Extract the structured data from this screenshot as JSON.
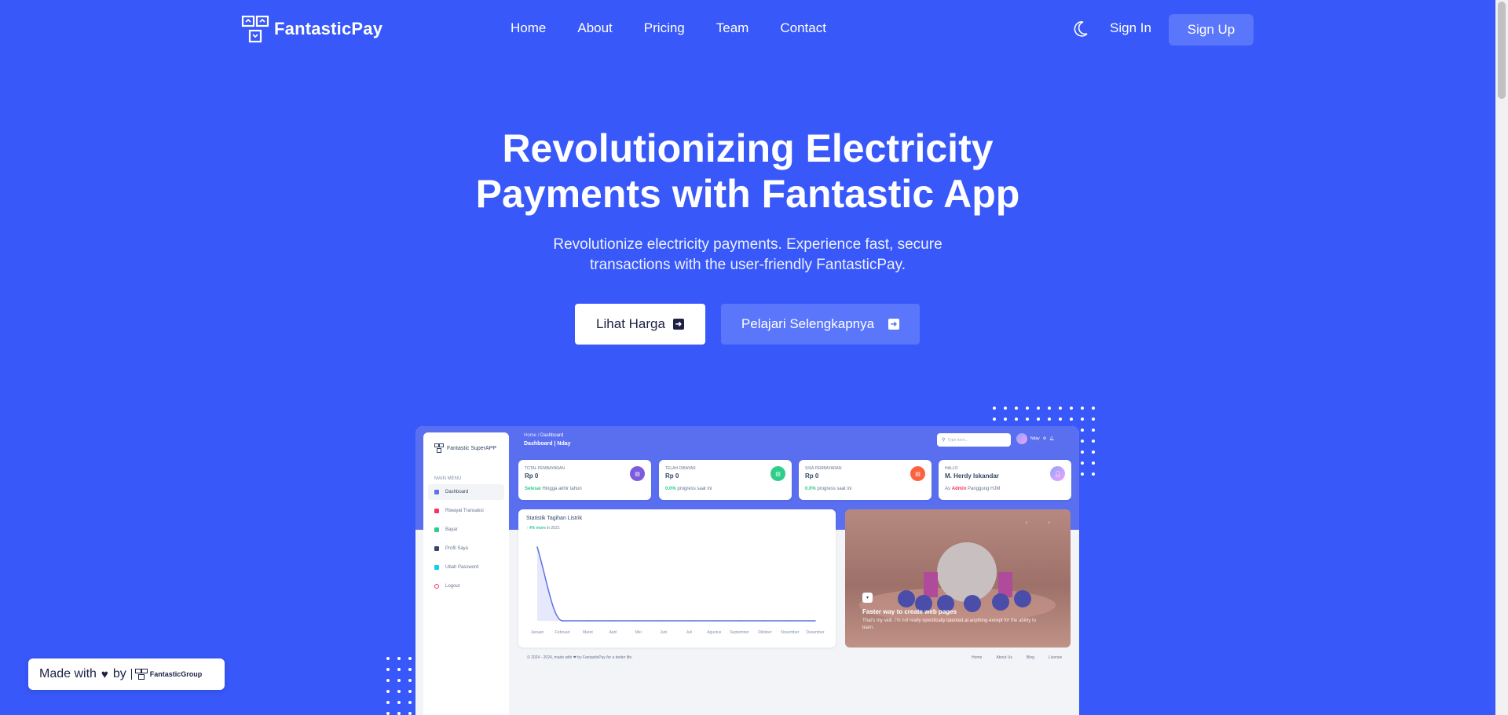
{
  "brand": {
    "name": "FantasticPay"
  },
  "nav": {
    "links": [
      "Home",
      "About",
      "Pricing",
      "Team",
      "Contact"
    ],
    "theme_icon": "moon-icon",
    "signin": "Sign In",
    "signup": "Sign Up"
  },
  "hero": {
    "title_line1": "Revolutionizing Electricity",
    "title_line2": "Payments with Fantastic App",
    "subtitle_line1": "Revolutionize electricity payments. Experience fast, secure",
    "subtitle_line2": "transactions with the user-friendly FantasticPay.",
    "primary_button": "Lihat Harga",
    "secondary_button": "Pelajari Selengkapnya"
  },
  "dashboard": {
    "brand": "Fantastic SuperAPP",
    "main_menu": "MAIN MENU",
    "menu": [
      "Dashboard",
      "Riwayat Transaksi",
      "Bayar",
      "Profil Saya",
      "Ubah Password",
      "Logout"
    ],
    "breadcrumb_home": "Home",
    "breadcrumb_sep": "/",
    "breadcrumb_current": "Dashboard",
    "page_title": "Dashboard | Nday",
    "search_placeholder": "Type here...",
    "user_name": "Nday",
    "cards": [
      {
        "label": "TOTAL PEMBAYARAN",
        "value": "Rp 0",
        "status": "Selesai",
        "note": "Hingga akhir tahun",
        "color": "#7c5cde"
      },
      {
        "label": "TELAH DIBAYAR",
        "value": "Rp 0",
        "status": "0.0%",
        "note": "progress saat ini",
        "color": "#2dce89"
      },
      {
        "label": "SISA PEMBAYARAN",
        "value": "Rp 0",
        "status": "0.0%",
        "note": "progress saat ini",
        "color": "#fb6340"
      },
      {
        "label": "HALLO",
        "value": "M. Herdy Iskandar",
        "prefix": "As",
        "role": "Admin",
        "place": "Panggung HJM"
      }
    ],
    "chart_title": "Statistik Tagihan Listrik",
    "chart_growth": "4% more",
    "chart_period": "in 2021",
    "image_card": {
      "title": "Faster way to create web pages",
      "desc": "That's my skill. I'm not really specifically talented at anything except for the ability to learn."
    },
    "footer": "© 2024 - 2024, made with ❤ by FantasticPay for a better life.",
    "footer_links": [
      "Home",
      "About Us",
      "Blog",
      "License"
    ]
  },
  "chart_data": {
    "type": "line",
    "categories": [
      "Januari",
      "Februari",
      "Maret",
      "April",
      "Mei",
      "Juni",
      "Juli",
      "Agustus",
      "September",
      "Oktober",
      "November",
      "Desember"
    ],
    "values": [
      1,
      0,
      0,
      0,
      0,
      0,
      0,
      0,
      0,
      0,
      0,
      0
    ],
    "title": "Statistik Tagihan Listrik",
    "ylim": [
      0,
      1
    ]
  },
  "made_with": {
    "text_before": "Made with",
    "text_after": "by",
    "org": "FantasticGroup"
  },
  "colors": {
    "background": "#3858f9",
    "accent": "#5a76fb",
    "white": "#ffffff"
  }
}
